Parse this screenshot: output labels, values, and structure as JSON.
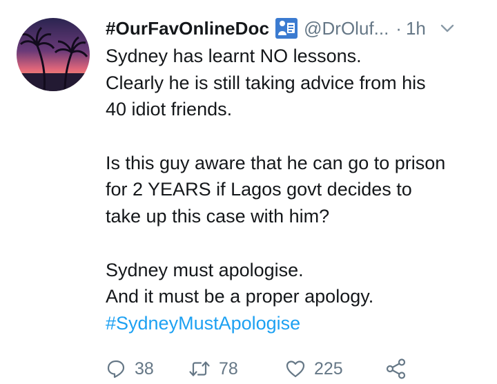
{
  "tweet": {
    "display_name": "#OurFavOnlineDoc",
    "handle": "@DrOluf...",
    "separator": "·",
    "time": "1h",
    "body_lines": [
      "Sydney has learnt NO lessons.",
      "Clearly he is still taking advice from his",
      "40 idiot friends.",
      "",
      "Is this guy aware that he can go to prison",
      "for 2 YEARS if Lagos govt decides to",
      "take up this case with him?",
      "",
      "Sydney must apologise.",
      "And it must be a proper apology."
    ],
    "hashtag": "#SydneyMustApologise"
  },
  "actions": {
    "replies": "38",
    "retweets": "78",
    "likes": "225"
  },
  "icons": {
    "badge": "doctor-emoji-icon",
    "menu": "chevron-down-icon",
    "reply": "reply-icon",
    "retweet": "retweet-icon",
    "like": "heart-icon",
    "share": "share-icon"
  },
  "colors": {
    "text": "#14171a",
    "muted": "#657786",
    "link": "#1da1f2"
  }
}
